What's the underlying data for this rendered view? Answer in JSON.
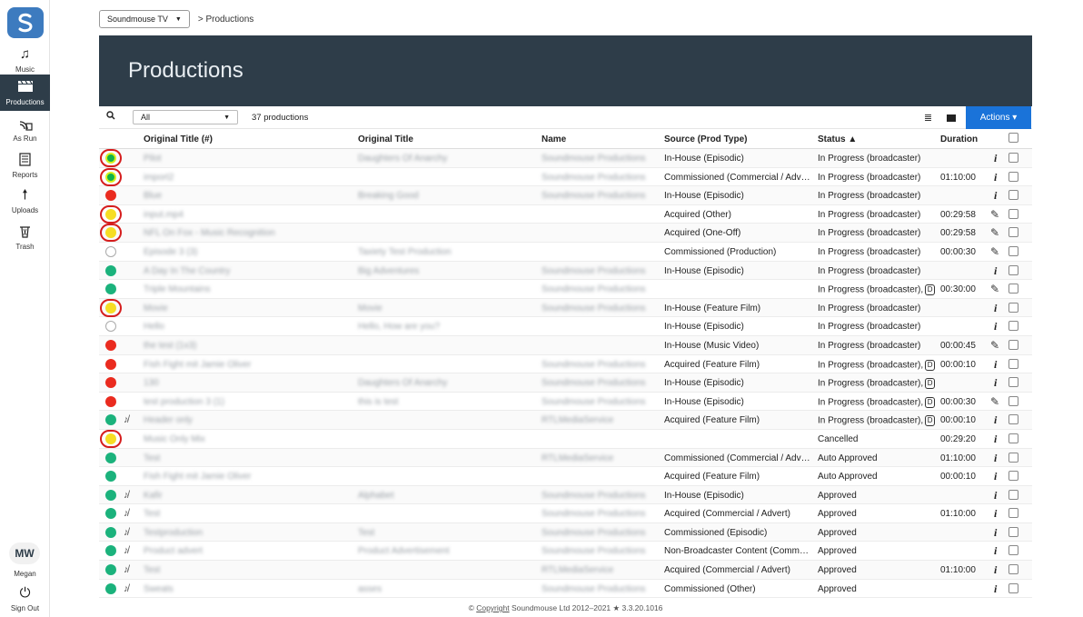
{
  "sidebar": {
    "logo": "S",
    "items": [
      {
        "label": "Music",
        "icon": "music-note-icon"
      },
      {
        "label": "Productions",
        "icon": "clapperboard-icon"
      },
      {
        "label": "As Run",
        "icon": "broadcast-icon"
      },
      {
        "label": "Reports",
        "icon": "document-icon"
      },
      {
        "label": "Uploads",
        "icon": "upload-icon"
      },
      {
        "label": "Trash",
        "icon": "trash-icon"
      }
    ],
    "user_initials": "MW",
    "user_name": "Megan",
    "sign_out": "Sign Out"
  },
  "breadcrumb": {
    "account": "Soundmouse TV",
    "page": "> Productions"
  },
  "page_title": "Productions",
  "toolbar": {
    "filter": "All",
    "count": "37 productions",
    "actions": "Actions ▾"
  },
  "columns": [
    "Original Title (#)",
    "Original Title",
    "Name",
    "Source (Prod Type)",
    "Status ▲",
    "Duration"
  ],
  "rows": [
    {
      "status": "lime",
      "ring": true,
      "t1": "Pilot",
      "t2": "Daughters Of Anarchy",
      "name": "Soundmouse Productions",
      "source": "In-House (Episodic)",
      "status_text": "In Progress (broadcaster)",
      "duration": "",
      "action": "info"
    },
    {
      "status": "lime",
      "ring": true,
      "t1": "import2",
      "t2": "",
      "name": "Soundmouse Productions",
      "source": "Commissioned (Commercial / Adv…",
      "status_text": "In Progress (broadcaster)",
      "duration": "01:10:00",
      "action": "info"
    },
    {
      "status": "red",
      "t1": "Blue",
      "t2": "Breaking Good",
      "name": "Soundmouse Productions",
      "source": "In-House (Episodic)",
      "status_text": "In Progress (broadcaster)",
      "duration": "",
      "action": "info"
    },
    {
      "status": "amber",
      "ring": true,
      "t1": "input.mp4",
      "t2": "",
      "name": "",
      "source": "Acquired (Other)",
      "status_text": "In Progress (broadcaster)",
      "duration": "00:29:58",
      "action": "pen"
    },
    {
      "status": "amber",
      "ring": true,
      "t1": "NFL On Fox - Music Recognition",
      "t2": "",
      "name": "",
      "source": "Acquired (One-Off)",
      "status_text": "In Progress (broadcaster)",
      "duration": "00:29:58",
      "action": "pen"
    },
    {
      "status": "empty",
      "t1": "Episode 3 (3)",
      "t2": "Taxiety Test Production",
      "name": "",
      "source": "Commissioned (Production)",
      "status_text": "In Progress (broadcaster)",
      "duration": "00:00:30",
      "action": "pen"
    },
    {
      "status": "green",
      "t1": "A Day In The Country",
      "t2": "Big Adventures",
      "name": "Soundmouse Productions",
      "source": "In-House (Episodic)",
      "status_text": "In Progress (broadcaster)",
      "duration": "",
      "action": "info"
    },
    {
      "status": "green",
      "t1": "Triple Mountains",
      "t2": "",
      "name": "Soundmouse Productions",
      "source": "",
      "status_text": "In Progress (broadcaster),",
      "badge": "D",
      "duration": "00:30:00",
      "action": "pen"
    },
    {
      "status": "amber",
      "ring": true,
      "t1": "Movie",
      "t2": "Movie",
      "name": "Soundmouse Productions",
      "source": "In-House (Feature Film)",
      "status_text": "In Progress (broadcaster)",
      "duration": "",
      "action": "info"
    },
    {
      "status": "empty",
      "t1": "Hello",
      "t2": "Hello, How are you?",
      "name": "",
      "source": "In-House (Episodic)",
      "status_text": "In Progress (broadcaster)",
      "duration": "",
      "action": "info"
    },
    {
      "status": "red",
      "t1": "the test (1x3)",
      "t2": "",
      "name": "",
      "source": "In-House (Music Video)",
      "status_text": "In Progress (broadcaster)",
      "duration": "00:00:45",
      "action": "pen"
    },
    {
      "status": "red",
      "t1": "Fish Fight mit Jamie Oliver",
      "t2": "",
      "name": "Soundmouse Productions",
      "source": "Acquired (Feature Film)",
      "status_text": "In Progress (broadcaster),",
      "badge": "D",
      "duration": "00:00:10",
      "action": "info"
    },
    {
      "status": "red",
      "t1": "130",
      "t2": "Daughters Of Anarchy",
      "name": "Soundmouse Productions",
      "source": "In-House (Episodic)",
      "status_text": "In Progress (broadcaster),",
      "badge": "D",
      "duration": "",
      "action": "info"
    },
    {
      "status": "red",
      "t1": "test production 3 (1)",
      "t2": "this is test",
      "name": "Soundmouse Productions",
      "source": "In-House (Episodic)",
      "status_text": "In Progress (broadcaster),",
      "badge": "D",
      "duration": "00:00:30",
      "action": "pen"
    },
    {
      "status": "green",
      "noicon": true,
      "t1": "Header only",
      "t2": "",
      "name": "RTLMediaService",
      "source": "Acquired (Feature Film)",
      "status_text": "In Progress (broadcaster),",
      "badge": "D",
      "duration": "00:00:10",
      "action": "info"
    },
    {
      "status": "amber",
      "ring": true,
      "t1": "Music Only Mix",
      "t2": "",
      "name": "",
      "source": "",
      "status_text": "Cancelled",
      "duration": "00:29:20",
      "action": "info"
    },
    {
      "status": "green",
      "t1": "Test",
      "t2": "",
      "name": "RTLMediaService",
      "source": "Commissioned (Commercial / Adv…",
      "status_text": "Auto Approved",
      "duration": "01:10:00",
      "action": "info"
    },
    {
      "status": "green",
      "t1": "Fish Fight mit Jamie Oliver",
      "t2": "",
      "name": "",
      "source": "Acquired (Feature Film)",
      "status_text": "Auto Approved",
      "duration": "00:00:10",
      "action": "info"
    },
    {
      "status": "green",
      "noicon": true,
      "t1": "Kafir",
      "t2": "Alphabet",
      "name": "Soundmouse Productions",
      "source": "In-House (Episodic)",
      "status_text": "Approved",
      "duration": "",
      "action": "info"
    },
    {
      "status": "green",
      "noicon": true,
      "t1": "Test",
      "t2": "",
      "name": "Soundmouse Productions",
      "source": "Acquired (Commercial / Advert)",
      "status_text": "Approved",
      "duration": "01:10:00",
      "action": "info"
    },
    {
      "status": "green",
      "noicon": true,
      "t1": "Testproduction",
      "t2": "Test",
      "name": "Soundmouse Productions",
      "source": "Commissioned (Episodic)",
      "status_text": "Approved",
      "duration": "",
      "action": "info"
    },
    {
      "status": "green",
      "noicon": true,
      "t1": "Product advert",
      "t2": "Product Advertisement",
      "name": "Soundmouse Productions",
      "source": "Non-Broadcaster Content (Comm…",
      "status_text": "Approved",
      "duration": "",
      "action": "info"
    },
    {
      "status": "green",
      "noicon": true,
      "t1": "Test",
      "t2": "",
      "name": "RTLMediaService",
      "source": "Acquired (Commercial / Advert)",
      "status_text": "Approved",
      "duration": "01:10:00",
      "action": "info"
    },
    {
      "status": "green",
      "noicon": true,
      "t1": "Sweats",
      "t2": "asses",
      "name": "Soundmouse Productions",
      "source": "Commissioned (Other)",
      "status_text": "Approved",
      "duration": "",
      "action": "info"
    }
  ],
  "footer": {
    "copyright_link": "Copyright",
    "text": " Soundmouse Ltd 2012–2021 ★ 3.3.20.1016",
    "prefix": "© "
  }
}
